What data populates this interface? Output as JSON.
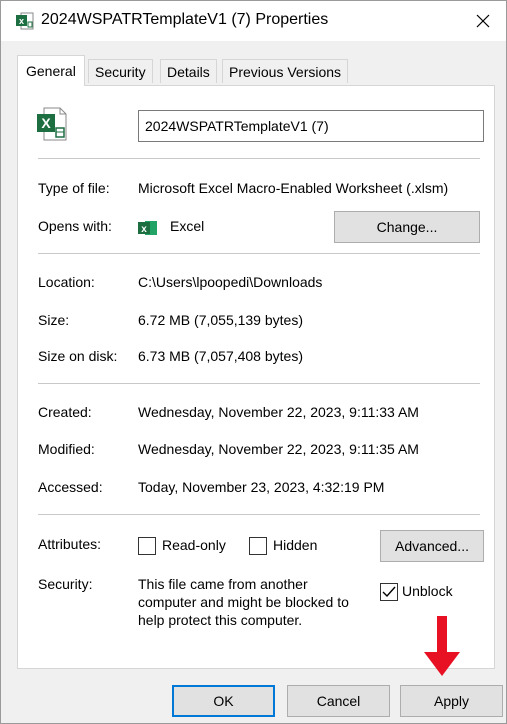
{
  "window": {
    "title": "2024WSPATRTemplateV1 (7) Properties",
    "close_label": "✕"
  },
  "tabs": [
    {
      "label": "General",
      "active": true
    },
    {
      "label": "Security",
      "active": false
    },
    {
      "label": "Details",
      "active": false
    },
    {
      "label": "Previous Versions",
      "active": false
    }
  ],
  "general": {
    "file_name": "2024WSPATRTemplateV1 (7)",
    "type_label": "Type of file:",
    "type_value": "Microsoft Excel Macro-Enabled Worksheet (.xlsm)",
    "opens_label": "Opens with:",
    "opens_app": "Excel",
    "change_button": "Change...",
    "location_label": "Location:",
    "location_value": "C:\\Users\\lpoopedi\\Downloads",
    "size_label": "Size:",
    "size_value": "6.72 MB (7,055,139 bytes)",
    "size_on_disk_label": "Size on disk:",
    "size_on_disk_value": "6.73 MB (7,057,408 bytes)",
    "created_label": "Created:",
    "created_value": "Wednesday, November 22, 2023, 9:11:33 AM",
    "modified_label": "Modified:",
    "modified_value": "Wednesday, November 22, 2023, 9:11:35 AM",
    "accessed_label": "Accessed:",
    "accessed_value": "Today, November 23, 2023, 4:32:19 PM",
    "attributes_label": "Attributes:",
    "readonly_label": "Read-only",
    "readonly_checked": false,
    "hidden_label": "Hidden",
    "hidden_checked": false,
    "advanced_button": "Advanced...",
    "security_label": "Security:",
    "security_text_1": "This file came from another",
    "security_text_2": "computer and might be blocked to",
    "security_text_3": "help protect this computer.",
    "unblock_label": "Unblock",
    "unblock_checked": true
  },
  "buttons": {
    "ok": "OK",
    "cancel": "Cancel",
    "apply": "Apply"
  },
  "colors": {
    "excel_green": "#1d6f42",
    "accent_blue": "#0078d7",
    "arrow_red": "#e81123"
  },
  "icons": [
    "excel-file-icon",
    "excel-app-icon",
    "close-icon",
    "checkmark-icon",
    "red-down-arrow-icon"
  ]
}
